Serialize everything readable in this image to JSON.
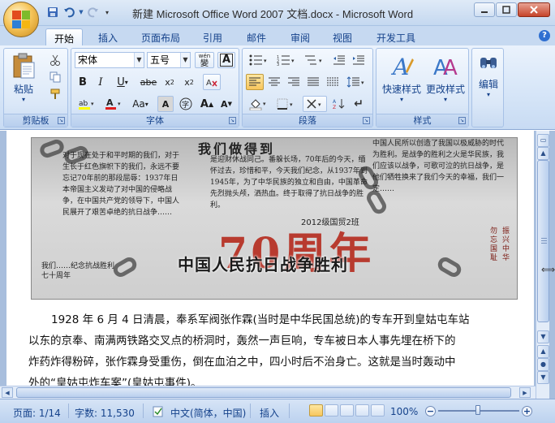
{
  "window": {
    "title": "新建 Microsoft Office Word 2007 文档.docx - Microsoft Word"
  },
  "quick_access": {
    "items": [
      "save-icon",
      "undo-icon",
      "redo-icon",
      "customize-icon"
    ]
  },
  "tabs": [
    {
      "label": "开始",
      "active": true
    },
    {
      "label": "插入"
    },
    {
      "label": "页面布局"
    },
    {
      "label": "引用"
    },
    {
      "label": "邮件"
    },
    {
      "label": "审阅"
    },
    {
      "label": "视图"
    },
    {
      "label": "开发工具"
    }
  ],
  "ribbon": {
    "clipboard": {
      "label": "剪贴板",
      "paste": "粘贴"
    },
    "font": {
      "label": "字体",
      "font_name": "宋体",
      "font_size": "五号",
      "wen": "變",
      "a_box": "A"
    },
    "paragraph": {
      "label": "段落"
    },
    "styles": {
      "label": "样式",
      "quick_styles": "快速样式",
      "change_styles": "更改样式"
    },
    "editing": {
      "label": "编辑"
    }
  },
  "document": {
    "banner": {
      "top_heading": "我们做得到",
      "left_text": "对于现在处于和平时期的我们，对于生长于红色旗帜下的我们，永远不要忘记70年前的那段屈辱：1937年日本帝国主义发动了对中国的侵略战争，在中国共产党的领导下，中国人民展开了艰苦卓绝的抗日战争……",
      "mid_text": "是迎财休战同己。番躲长场，70年后的今天，缅怀过去，珍惜和平，今天我们纪念，从1937年到1945年，为了中华民族的独立和自由，中国革命先烈抛头颅，洒热血。终于取得了抗日战争的胜利。",
      "right_text": "中国人民所以创造了我国以极威胁的时代为胜利。是战争的胜利之火是华民族，我们应该以战争，可歌可泣的抗日战争，是他们牺牲换来了我们今天的幸福，我们一定……",
      "year": "2012级国贸2班",
      "big_text": "70周年",
      "main_title": "中国人民抗日战争胜利",
      "vertical_1": "勿忘国耻",
      "vertical_2": "振兴中华",
      "bottom_text": "我们……纪念抗战胜利七十周年"
    },
    "paragraph": [
      "1928 年 6 月 4 日清晨，奉系军阀张作霖(当时是中华民国总统)的专车开到皇姑屯车站",
      "以东的京奉、南满两铁路交叉点的桥洞时，轰然一声巨响，专车被日本人事先埋在桥下的",
      "炸药炸得粉碎，张作霖身受重伤，倒在血泊之中，四小时后不治身亡。这就是当时轰动中",
      "外的“皇姑屯炸车案”(皇姑屯事件)。"
    ]
  },
  "status_bar": {
    "page": "页面: 1/14",
    "words": "字数: 11,530",
    "language": "中文(简体，中国)",
    "insert_mode": "插入",
    "zoom": "100%"
  }
}
